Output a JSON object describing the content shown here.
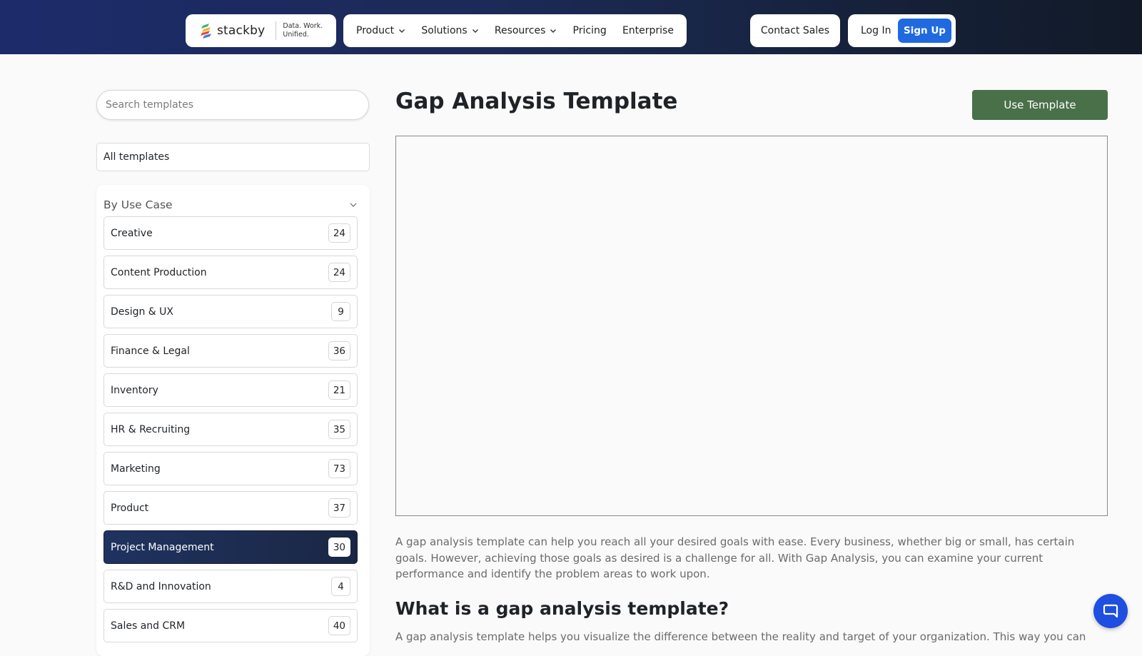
{
  "header": {
    "logo": {
      "wordmark": "stackby",
      "tagline_line1": "Data. Work.",
      "tagline_line2": "Unified."
    },
    "nav": [
      {
        "label": "Product",
        "has_dropdown": true
      },
      {
        "label": "Solutions",
        "has_dropdown": true
      },
      {
        "label": "Resources",
        "has_dropdown": true
      },
      {
        "label": "Pricing",
        "has_dropdown": false
      },
      {
        "label": "Enterprise",
        "has_dropdown": false
      }
    ],
    "contact_sales": "Contact Sales",
    "log_in": "Log In",
    "sign_up": "Sign Up"
  },
  "sidebar": {
    "search_placeholder": "Search templates",
    "all_templates": "All templates",
    "section_title": "By Use Case",
    "categories": [
      {
        "label": "Creative",
        "count": "24",
        "active": false
      },
      {
        "label": "Content Production",
        "count": "24",
        "active": false
      },
      {
        "label": "Design & UX",
        "count": "9",
        "active": false
      },
      {
        "label": "Finance & Legal",
        "count": "36",
        "active": false
      },
      {
        "label": "Inventory",
        "count": "21",
        "active": false
      },
      {
        "label": "HR & Recruiting",
        "count": "35",
        "active": false
      },
      {
        "label": "Marketing",
        "count": "73",
        "active": false
      },
      {
        "label": "Product",
        "count": "37",
        "active": false
      },
      {
        "label": "Project Management",
        "count": "30",
        "active": true
      },
      {
        "label": "R&D and Innovation",
        "count": "4",
        "active": false
      },
      {
        "label": "Sales and CRM",
        "count": "40",
        "active": false
      }
    ]
  },
  "main": {
    "title": "Gap Analysis Template",
    "use_template": "Use Template",
    "description": "A gap analysis template can help you reach all your desired goals with ease. Every business, whether big or small, has certain goals. However, achieving those goals as desired is a challenge for all. With Gap Analysis, you can examine your current performance and identify the problem areas to work upon.",
    "section_heading": "What is a gap analysis template?",
    "section_text": "A gap analysis template helps you visualize the difference between the reality and target of your organization. This way you can"
  },
  "colors": {
    "signup": "#1f6ae0",
    "use_template": "#4a7049",
    "active_category": "#1f3360",
    "chat_button": "#1f4fe0"
  },
  "icons": [
    "stackby-logo-icon",
    "chevron-down-icon",
    "chat-icon"
  ]
}
